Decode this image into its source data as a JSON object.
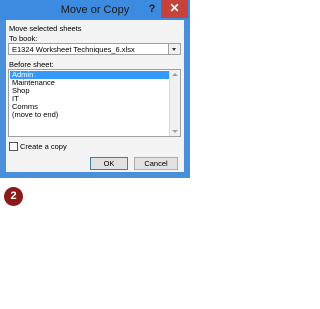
{
  "dialog": {
    "title": "Move or Copy",
    "help_glyph": "?",
    "close_glyph": "✕",
    "move_selected_label": "Move selected sheets",
    "to_book_label": "To book:",
    "to_book_value": "E1324 Worksheet Techniques_6.xlsx",
    "before_sheet_label": "Before sheet:",
    "sheets": [
      "Admin",
      "Maintenance",
      "Shop",
      "IT",
      "Comms",
      "(move to end)"
    ],
    "selected_sheet": "Admin",
    "create_copy_label": "Create a copy",
    "create_copy_checked": false,
    "ok_label": "OK",
    "cancel_label": "Cancel"
  },
  "step_badge": "2",
  "colors": {
    "titlebar": "#3d8be0",
    "close_button": "#c7423a",
    "selection": "#3399ff",
    "badge": "#8b1a1a"
  }
}
